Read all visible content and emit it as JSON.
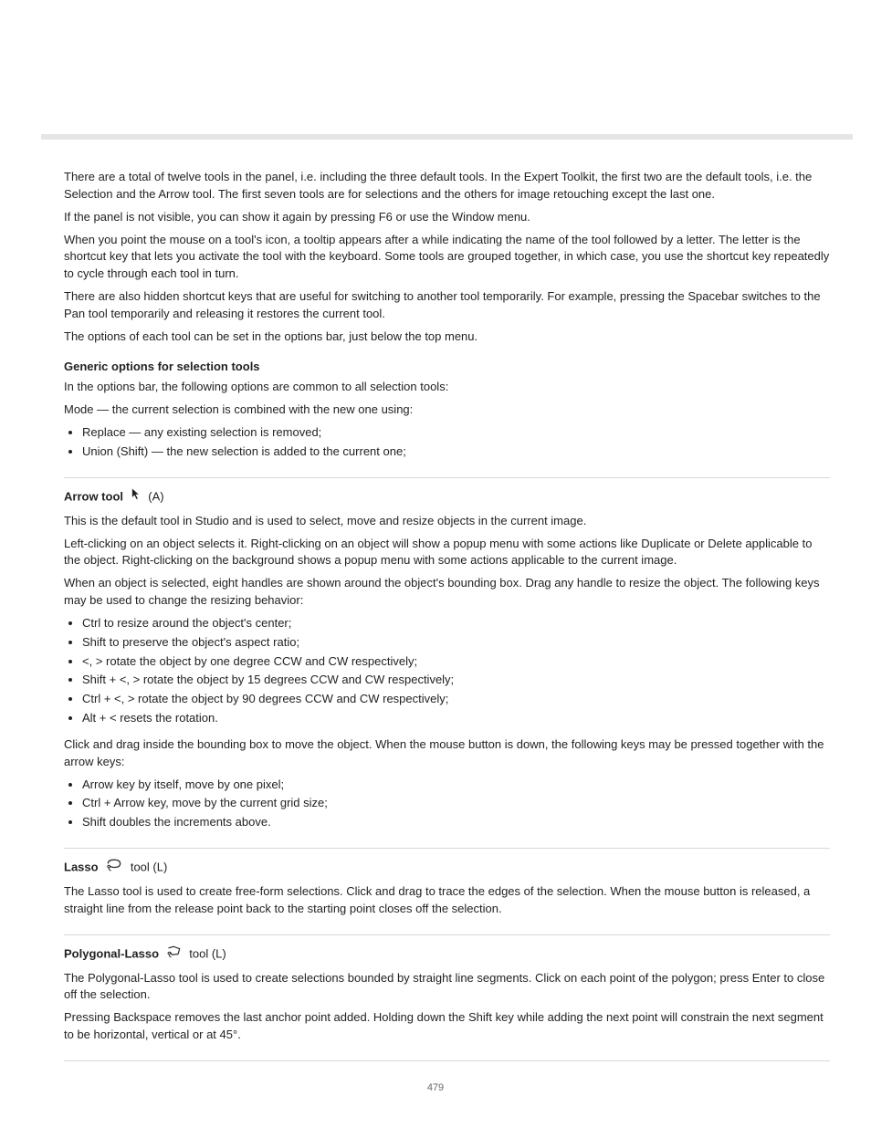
{
  "intro": {
    "p1": "There are a total of twelve tools in the panel, i.e. including the three default tools. In the Expert Toolkit, the first two are the default tools, i.e. the Selection and the Arrow tool. The first seven tools are for selections and the others for image retouching except the last one.",
    "p2": "If the panel is not visible, you can show it again by pressing F6 or use the Window menu.",
    "p3": "When you point the mouse on a tool's icon, a tooltip appears after a while indicating the name of the tool followed by a letter. The letter is the shortcut key that lets you activate the tool with the keyboard. Some tools are grouped together, in which case, you use the shortcut key repeatedly to cycle through each tool in turn.",
    "p4": "There are also hidden shortcut keys that are useful for switching to another tool temporarily. For example, pressing the Spacebar switches to the Pan tool temporarily and releasing it restores the current tool.",
    "p5": "The options of each tool can be set in the options bar, just below the top menu.",
    "generic_heading": "Generic options for selection tools",
    "generic_p": "In the options bar, the following options are common to all selection tools:",
    "mode_label_prefix": "Mode — the current selection is combined with the new one using:",
    "modes": [
      "Replace — any existing selection is removed;",
      "Union (Shift) — the new selection is added to the current one;"
    ]
  },
  "arrow": {
    "title_prefix": "Arrow tool",
    "title_suffix": " (A)",
    "p1": "This is the default tool in Studio and is used to select, move and resize objects in the current image.",
    "p2": "Left-clicking on an object selects it. Right-clicking on an object will show a popup menu with some actions like Duplicate or Delete applicable to the object. Right-clicking on the background shows a popup menu with some actions applicable to the current image.",
    "p3": "When an object is selected, eight handles are shown around the object's bounding box. Drag any handle to resize the object. The following keys may be used to change the resizing behavior:",
    "resize_keys": [
      "Ctrl to resize around the object's center;",
      "Shift to preserve the object's aspect ratio;",
      "<, > rotate the object by one degree CCW and CW respectively;",
      "Shift + <, > rotate the object by 15 degrees CCW and CW respectively;",
      "Ctrl + <, > rotate the object by 90 degrees CCW and CW respectively;",
      "Alt + < resets the rotation."
    ],
    "p4": "Click and drag inside the bounding box to move the object. When the mouse button is down, the following keys may be pressed together with the arrow keys:",
    "move_keys": [
      "Arrow key by itself, move by one pixel;",
      "Ctrl + Arrow key, move by the current grid size;",
      "Shift doubles the increments above."
    ]
  },
  "lasso": {
    "title_prefix": "Lasso",
    "title_suffix": " tool (L)",
    "body": "The Lasso tool is used to create free-form selections. Click and drag to trace the edges of the selection. When the mouse button is released, a straight line from the release point back to the starting point closes off the selection."
  },
  "polylasso": {
    "title_prefix": "Polygonal-Lasso",
    "title_suffix": " tool (L)",
    "p1": "The Polygonal-Lasso tool is used to create selections bounded by straight line segments. Click on each point of the polygon; press Enter to close off the selection.",
    "p2": "Pressing Backspace removes the last anchor point added. Holding down the Shift key while adding the next point will constrain the next segment to be horizontal, vertical or at 45°."
  },
  "page_number": "479"
}
